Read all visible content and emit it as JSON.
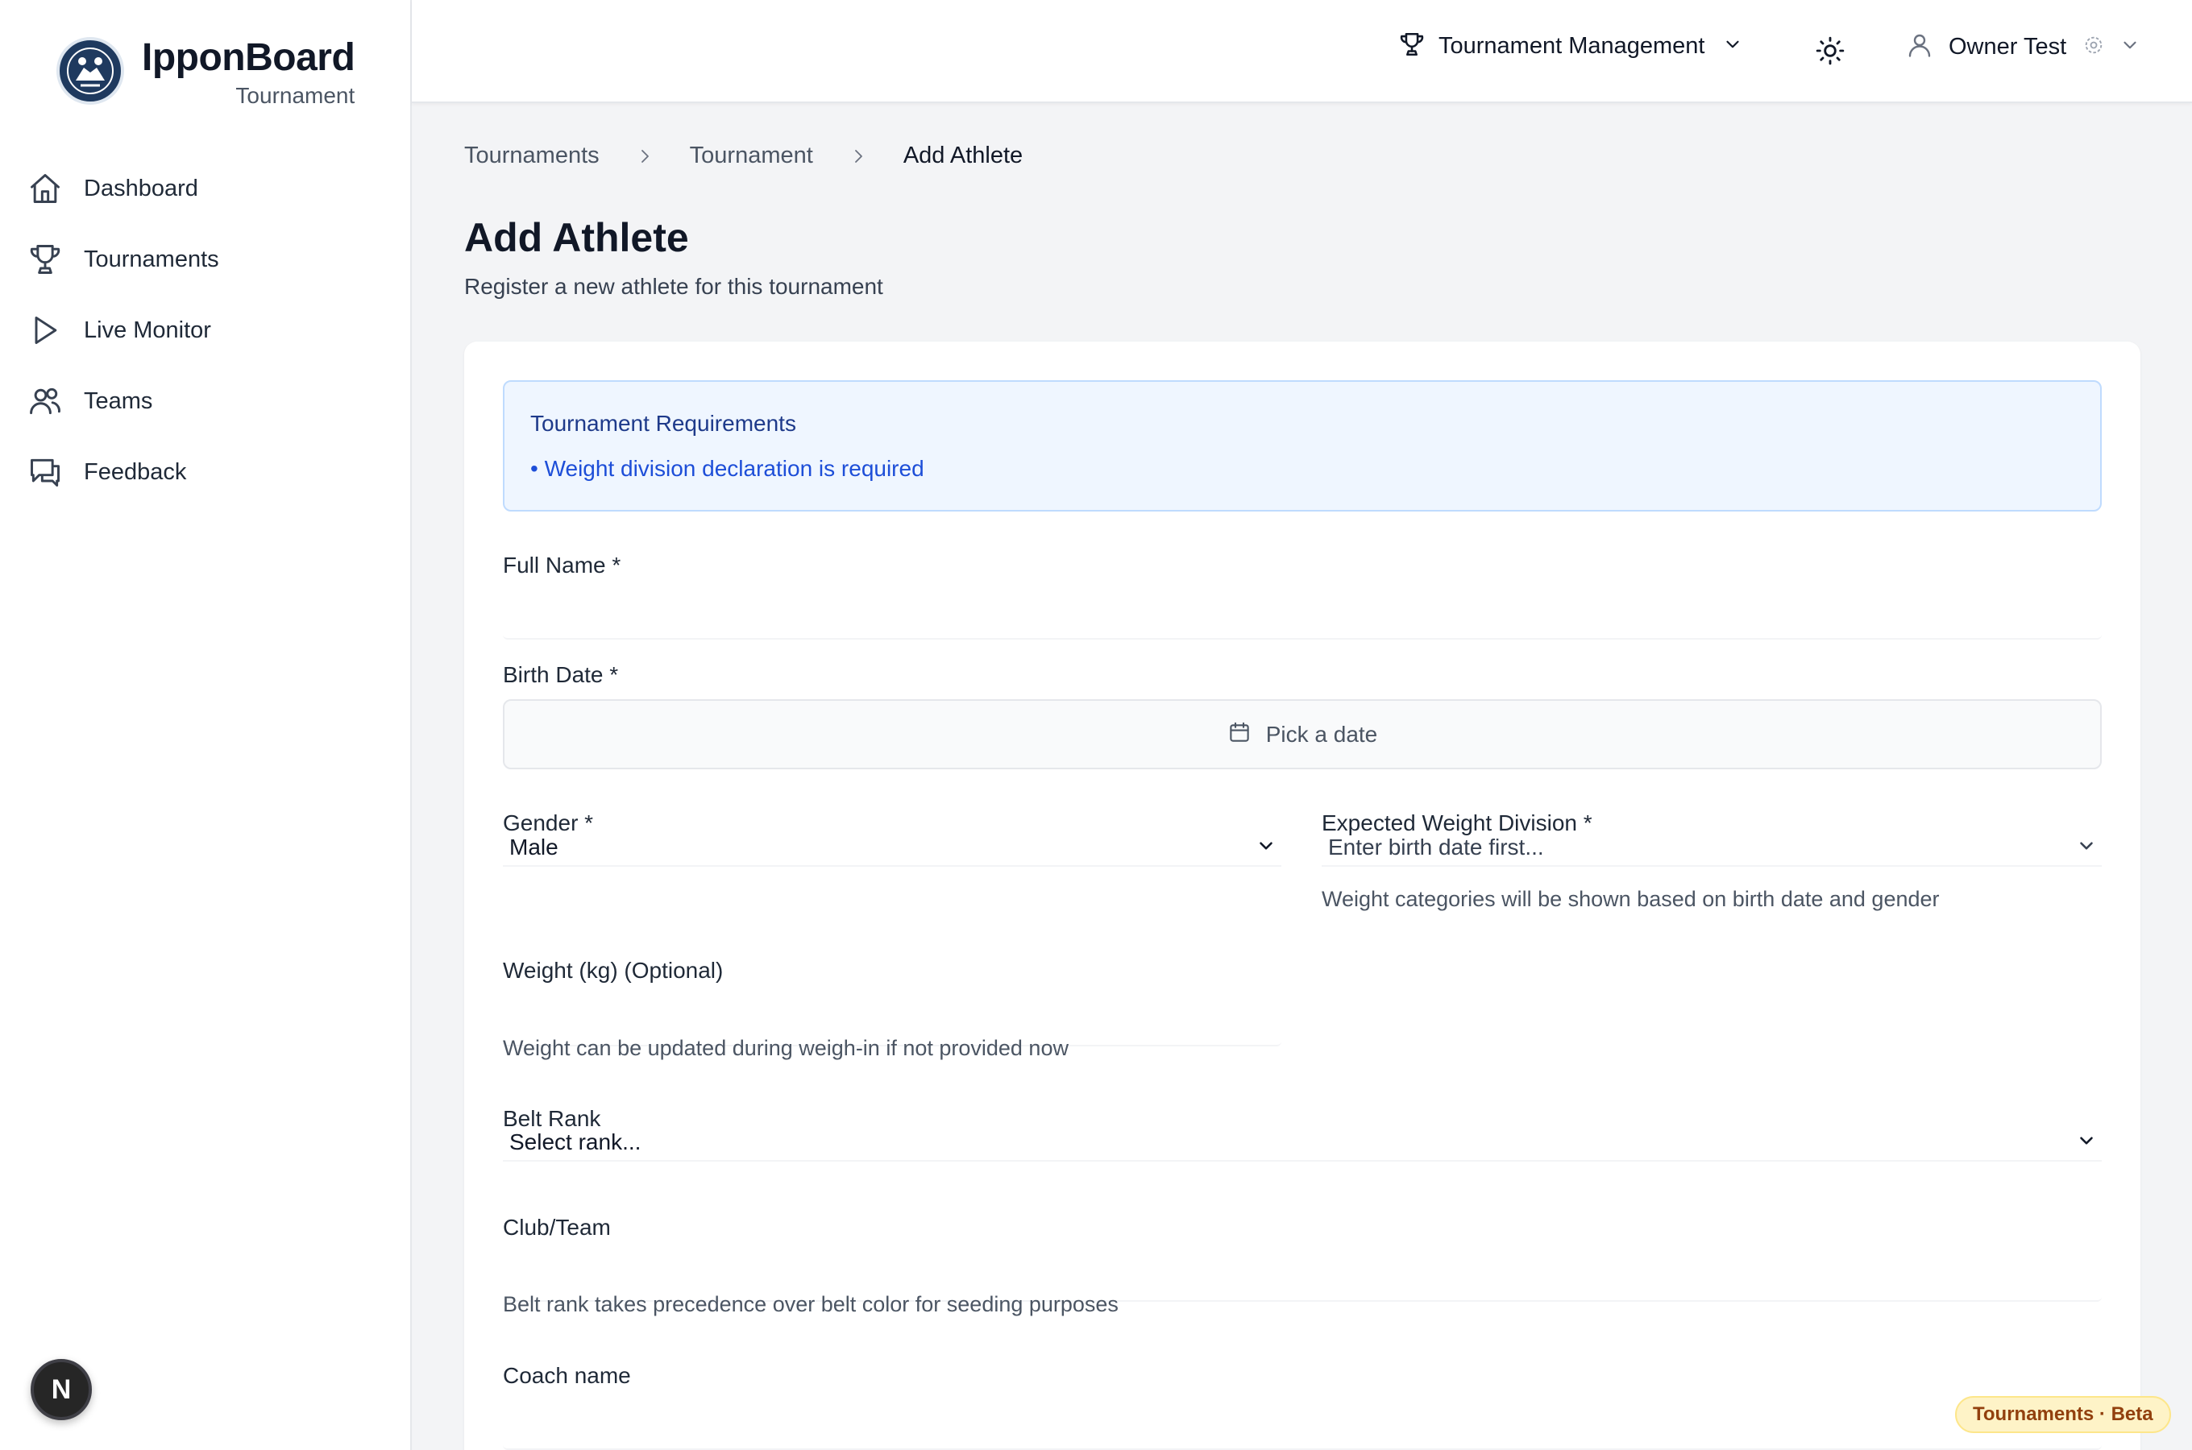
{
  "brand": {
    "title": "IpponBoard",
    "subtitle": "Tournament"
  },
  "nav": [
    {
      "label": "Dashboard",
      "icon": "home-icon"
    },
    {
      "label": "Tournaments",
      "icon": "trophy-icon"
    },
    {
      "label": "Live Monitor",
      "icon": "play-icon"
    },
    {
      "label": "Teams",
      "icon": "users-icon"
    },
    {
      "label": "Feedback",
      "icon": "chat-icon"
    }
  ],
  "header": {
    "tournament_menu": "Tournament Management",
    "user_name": "Owner Test"
  },
  "breadcrumb": [
    "Tournaments",
    "Tournament",
    "Add Athlete"
  ],
  "page": {
    "title": "Add Athlete",
    "subtitle": "Register a new athlete for this tournament"
  },
  "requirements": {
    "title": "Tournament Requirements",
    "items": [
      "• Weight division declaration is required"
    ]
  },
  "form": {
    "full_name": {
      "label": "Full Name *",
      "value": ""
    },
    "birth_date": {
      "label": "Birth Date *",
      "placeholder": "Pick a date"
    },
    "gender": {
      "label": "Gender *",
      "value": "Male"
    },
    "weight_division": {
      "label": "Expected Weight Division *",
      "value": "Enter birth date first...",
      "help": "Weight categories will be shown based on birth date and gender"
    },
    "weight": {
      "label": "Weight (kg) (Optional)",
      "value": "",
      "help": "Weight can be updated during weigh-in if not provided now"
    },
    "belt_rank": {
      "label": "Belt Rank",
      "value": "Select rank..."
    },
    "club": {
      "label": "Club/Team",
      "value": "",
      "help": "Belt rank takes precedence over belt color for seeding purposes"
    },
    "coach": {
      "label": "Coach name",
      "value": ""
    }
  },
  "badges": {
    "dev_indicator": "N",
    "beta": "Tournaments · Beta"
  },
  "colors": {
    "accent_blue": "#1d4ed8",
    "info_bg": "#eff6ff",
    "beta_bg": "#fef3c7"
  }
}
